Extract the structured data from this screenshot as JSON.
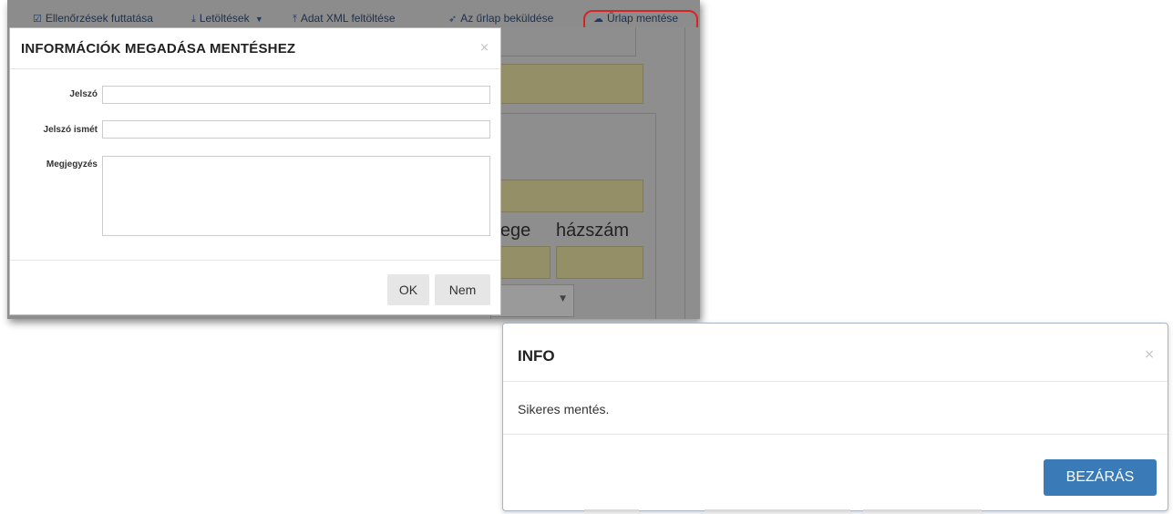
{
  "toolbar": {
    "items": [
      {
        "icon": "check-square-icon",
        "label": "Ellenőrzések futtatása"
      },
      {
        "icon": "download-icon",
        "label": "Letöltések"
      },
      {
        "icon": "upload-icon",
        "label": "Adat XML feltöltése"
      },
      {
        "icon": "send-icon",
        "label": "Az űrlap beküldése"
      },
      {
        "icon": "cloud-upload-icon",
        "label": "Űrlap mentése"
      }
    ],
    "highlight_color": "#d62424"
  },
  "background_form": {
    "text_1": "llege",
    "text_2": "házszám",
    "field_color": "#958f68"
  },
  "save_dialog": {
    "title": "INFORMÁCIÓK MEGADÁSA MENTÉSHEZ",
    "close_glyph": "×",
    "password_label": "Jelszó",
    "password_value": "",
    "password_repeat_label": "Jelszó ismét",
    "password_repeat_value": "",
    "comment_label": "Megjegyzés",
    "comment_value": "",
    "ok_label": "OK",
    "no_label": "Nem"
  },
  "info_dialog": {
    "title": "INFO",
    "close_glyph": "×",
    "message": "Sikeres mentés.",
    "close_label": "BEZÁRÁS",
    "button_color": "#3a7ab7"
  }
}
